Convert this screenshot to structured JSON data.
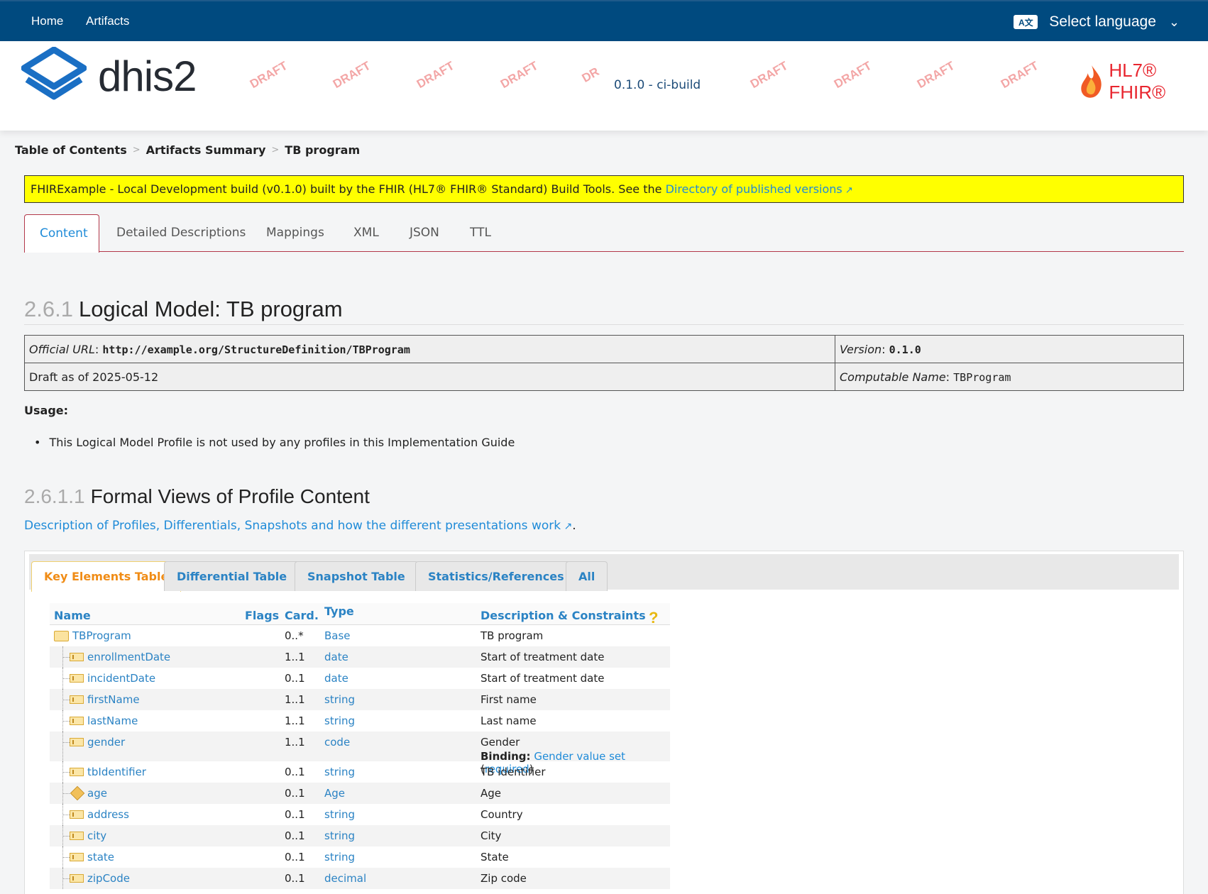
{
  "nav": {
    "home": "Home",
    "artifacts": "Artifacts",
    "language": "Select language",
    "lang_icon_text": "A文"
  },
  "header": {
    "logo_text": "dhis2",
    "draft_labels": [
      "DRAFT",
      "DRAFT",
      "DRAFT",
      "DRAFT",
      "DR",
      "DRAFT",
      "DRAFT",
      "DRAFT",
      "DRAFT"
    ],
    "version": "0.1.0 - ci-build",
    "fhir_text": "HL7® FHIR®"
  },
  "breadcrumb": [
    "Table of Contents",
    "Artifacts Summary",
    "TB program"
  ],
  "notice": {
    "text": "FHIRExample - Local Development build (v0.1.0) built by the FHIR (HL7® FHIR® Standard) Build Tools. See the ",
    "link": "Directory of published versions"
  },
  "tabs": [
    "Content",
    "Detailed Descriptions",
    "Mappings",
    "XML",
    "JSON",
    "TTL"
  ],
  "title": {
    "num": "2.6.1",
    "text": "Logical Model: TB program"
  },
  "info": {
    "url_label": "Official URL",
    "url": "http://example.org/StructureDefinition/TBProgram",
    "version_label": "Version",
    "version": "0.1.0",
    "status": "Draft as of 2025-05-12",
    "computable_label": "Computable Name",
    "computable": "TBProgram"
  },
  "usage": {
    "label": "Usage:",
    "item": "This Logical Model Profile is not used by any profiles in this Implementation Guide"
  },
  "formal": {
    "num": "2.6.1.1",
    "title": "Formal Views of Profile Content",
    "desc_link": "Description of Profiles, Differentials, Snapshots and how the different presentations work",
    "desc_end": "."
  },
  "subtabs": [
    "Key Elements Table",
    "Differential Table",
    "Snapshot Table",
    "Statistics/References",
    "All"
  ],
  "table": {
    "headers": {
      "name": "Name",
      "flags": "Flags",
      "card": "Card.",
      "type": "Type",
      "desc": "Description & Constraints",
      "help": "?"
    },
    "root": {
      "name": "TBProgram",
      "card": "0..*",
      "type": "Base",
      "desc": "TB program"
    },
    "rows": [
      {
        "name": "enrollmentDate",
        "card": "1..1",
        "type": "date",
        "desc": "Start of treatment date"
      },
      {
        "name": "incidentDate",
        "card": "0..1",
        "type": "date",
        "desc": "Start of treatment date"
      },
      {
        "name": "firstName",
        "card": "1..1",
        "type": "string",
        "desc": "First name"
      },
      {
        "name": "lastName",
        "card": "1..1",
        "type": "string",
        "desc": "Last name"
      },
      {
        "name": "gender",
        "card": "1..1",
        "type": "code",
        "desc": "Gender"
      },
      {
        "name": "tbIdentifier",
        "card": "0..1",
        "type": "string",
        "desc": "TB identifier"
      },
      {
        "name": "age",
        "card": "0..1",
        "type": "Age",
        "desc": "Age"
      },
      {
        "name": "address",
        "card": "0..1",
        "type": "string",
        "desc": "Country"
      },
      {
        "name": "city",
        "card": "0..1",
        "type": "string",
        "desc": "City"
      },
      {
        "name": "state",
        "card": "0..1",
        "type": "string",
        "desc": "State"
      },
      {
        "name": "zipCode",
        "card": "0..1",
        "type": "decimal",
        "desc": "Zip code"
      }
    ],
    "binding": {
      "label": "Binding:",
      "valueset": "Gender value set",
      "strength": "required"
    }
  }
}
